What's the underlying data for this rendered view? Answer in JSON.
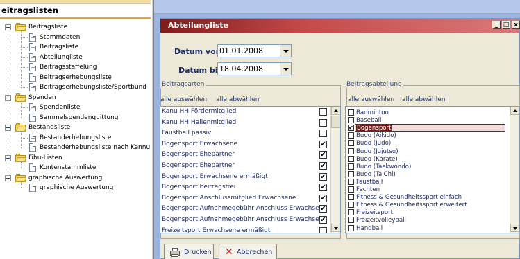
{
  "left_panel": {
    "title": "eitragslisten",
    "tree": [
      {
        "label": "Beitragsliste",
        "type": "folder",
        "level": 0,
        "expanded": true
      },
      {
        "label": "Stammdaten",
        "type": "doc",
        "level": 1
      },
      {
        "label": "Beitragsliste",
        "type": "doc",
        "level": 1
      },
      {
        "label": "Abteilungliste",
        "type": "doc",
        "level": 1
      },
      {
        "label": "Beitragsstaffelung",
        "type": "doc",
        "level": 1
      },
      {
        "label": "Beitragserhebungsliste",
        "type": "doc",
        "level": 1
      },
      {
        "label": "Beitragserhebungsliste/Sportbund",
        "type": "doc",
        "level": 1
      },
      {
        "label": "Spenden",
        "type": "folder",
        "level": 0,
        "expanded": true
      },
      {
        "label": "Spendenliste",
        "type": "doc",
        "level": 1
      },
      {
        "label": "Sammelspendenquittung",
        "type": "doc",
        "level": 1
      },
      {
        "label": "Bestandsliste",
        "type": "folder",
        "level": 0,
        "expanded": true
      },
      {
        "label": "Bestanderhebungsliste",
        "type": "doc",
        "level": 1
      },
      {
        "label": "Bestanderhebungsliste nach Kennu",
        "type": "doc",
        "level": 1
      },
      {
        "label": "Fibu-Listen",
        "type": "folder",
        "level": 0,
        "expanded": true
      },
      {
        "label": "Kontenstammliste",
        "type": "doc",
        "level": 1
      },
      {
        "label": "graphische Auswertung",
        "type": "folder",
        "level": 0,
        "expanded": true
      },
      {
        "label": "graphische Auswertung",
        "type": "doc",
        "level": 1
      }
    ]
  },
  "window": {
    "title": "Abteilungliste",
    "controls": {
      "minimize": "_",
      "restore": "□",
      "close": "x"
    },
    "date_from": {
      "label": "Datum von:",
      "value": "01.01.2008"
    },
    "date_to": {
      "label": "Datum bis:",
      "value": "18.04.2008"
    },
    "beitragsarten": {
      "title": "Beitragsarten",
      "select_all": "alle auswählen",
      "deselect_all": "alle abwählen",
      "items": [
        {
          "label": "Kanu HH Fördermitglied",
          "checked": false
        },
        {
          "label": "Kanu HH Hallenmitglied",
          "checked": false
        },
        {
          "label": "Faustball passiv",
          "checked": false
        },
        {
          "label": "Bogensport Erwachsene",
          "checked": true
        },
        {
          "label": "Bogensport Ehepartner",
          "checked": true
        },
        {
          "label": "Bogensport Ehepartner",
          "checked": true
        },
        {
          "label": "Bogensport Erwachsene ermäßigt",
          "checked": true
        },
        {
          "label": "Bogensport beitragsfrei",
          "checked": true
        },
        {
          "label": "Bogensport Anschlussmitglied Erwachsene",
          "checked": true
        },
        {
          "label": "Bogensport Aufnahmegebühr Anschluss Erwachsene",
          "checked": true
        },
        {
          "label": "Bogensport Aufnahmegebühr Anschluss Erwachsene",
          "checked": true
        },
        {
          "label": "Freizeitsport Erwachsene ermäßigt",
          "checked": false
        }
      ]
    },
    "beitragsabteilung": {
      "title": "Beitragsabteilung",
      "select_all": "alle auswählen",
      "deselect_all": "alle abwählen",
      "items": [
        {
          "label": "Badminton",
          "checked": false,
          "selected": false
        },
        {
          "label": "Baseball",
          "checked": false,
          "selected": false
        },
        {
          "label": "Bogensport",
          "checked": true,
          "selected": true
        },
        {
          "label": "Budo (Aikido)",
          "checked": false,
          "selected": false
        },
        {
          "label": "Budo (Judo)",
          "checked": false,
          "selected": false
        },
        {
          "label": "Budo (Jujutsu)",
          "checked": false,
          "selected": false
        },
        {
          "label": "Budo (Karate)",
          "checked": false,
          "selected": false
        },
        {
          "label": "Budo (Taekwondo)",
          "checked": false,
          "selected": false
        },
        {
          "label": "Budo (TaiChi)",
          "checked": false,
          "selected": false
        },
        {
          "label": "Faustball",
          "checked": false,
          "selected": false
        },
        {
          "label": "Fechten",
          "checked": false,
          "selected": false
        },
        {
          "label": "Fitness & Gesundheitssport einfach",
          "checked": false,
          "selected": false
        },
        {
          "label": "Fitness & Gesundheitssport erweitert",
          "checked": false,
          "selected": false
        },
        {
          "label": "Freizeitsport",
          "checked": false,
          "selected": false
        },
        {
          "label": "Freizeitvolleyball",
          "checked": false,
          "selected": false
        },
        {
          "label": "Handball",
          "checked": false,
          "selected": false
        }
      ]
    },
    "buttons": {
      "print": "Drucken",
      "cancel": "Abbrechen"
    }
  },
  "colors": {
    "title_bar": "#a83232",
    "desktop": "#9db4de",
    "link_text": "#14308a",
    "selection": "#7a1a1a"
  },
  "icons": {
    "folder": "folder-icon",
    "document": "document-icon",
    "printer": "printer-icon",
    "cancel": "cancel-x-icon"
  }
}
